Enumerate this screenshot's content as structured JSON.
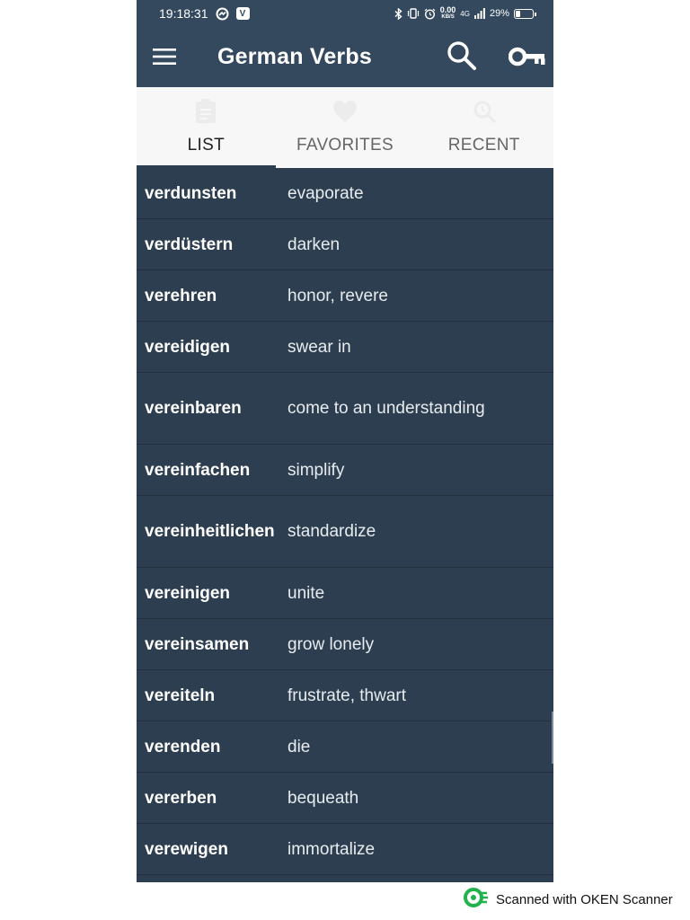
{
  "status_bar": {
    "time": "19:18:31",
    "net_speed_value": "0.00",
    "net_speed_unit": "KB/S",
    "network": "4G",
    "battery": "29%",
    "battery_level_percent": 29
  },
  "toolbar": {
    "title": "German Verbs"
  },
  "tabs": [
    {
      "label": "LIST",
      "active": true
    },
    {
      "label": "FAVORITES",
      "active": false
    },
    {
      "label": "RECENT",
      "active": false
    }
  ],
  "verbs": [
    {
      "german": "verdunsten",
      "english": "evaporate"
    },
    {
      "german": "verdüstern",
      "english": "darken"
    },
    {
      "german": "verehren",
      "english": "honor, revere"
    },
    {
      "german": "vereidigen",
      "english": "swear in"
    },
    {
      "german": "vereinbaren",
      "english": "come to an understanding"
    },
    {
      "german": "vereinfachen",
      "english": "simplify"
    },
    {
      "german": "vereinheitlichen",
      "english": "standardize"
    },
    {
      "german": "vereinigen",
      "english": "unite"
    },
    {
      "german": "vereinsamen",
      "english": "grow lonely"
    },
    {
      "german": "vereiteln",
      "english": "frustrate, thwart"
    },
    {
      "german": "verenden",
      "english": "die"
    },
    {
      "german": "vererben",
      "english": "bequeath"
    },
    {
      "german": "verewigen",
      "english": "immortalize"
    }
  ],
  "watermark": {
    "text": "Scanned with OKEN Scanner"
  },
  "colors": {
    "toolbar": "#34495e",
    "list_background": "#2c3e50",
    "tab_bar": "#f7f7f7",
    "watermark_logo": "#22b14c"
  }
}
